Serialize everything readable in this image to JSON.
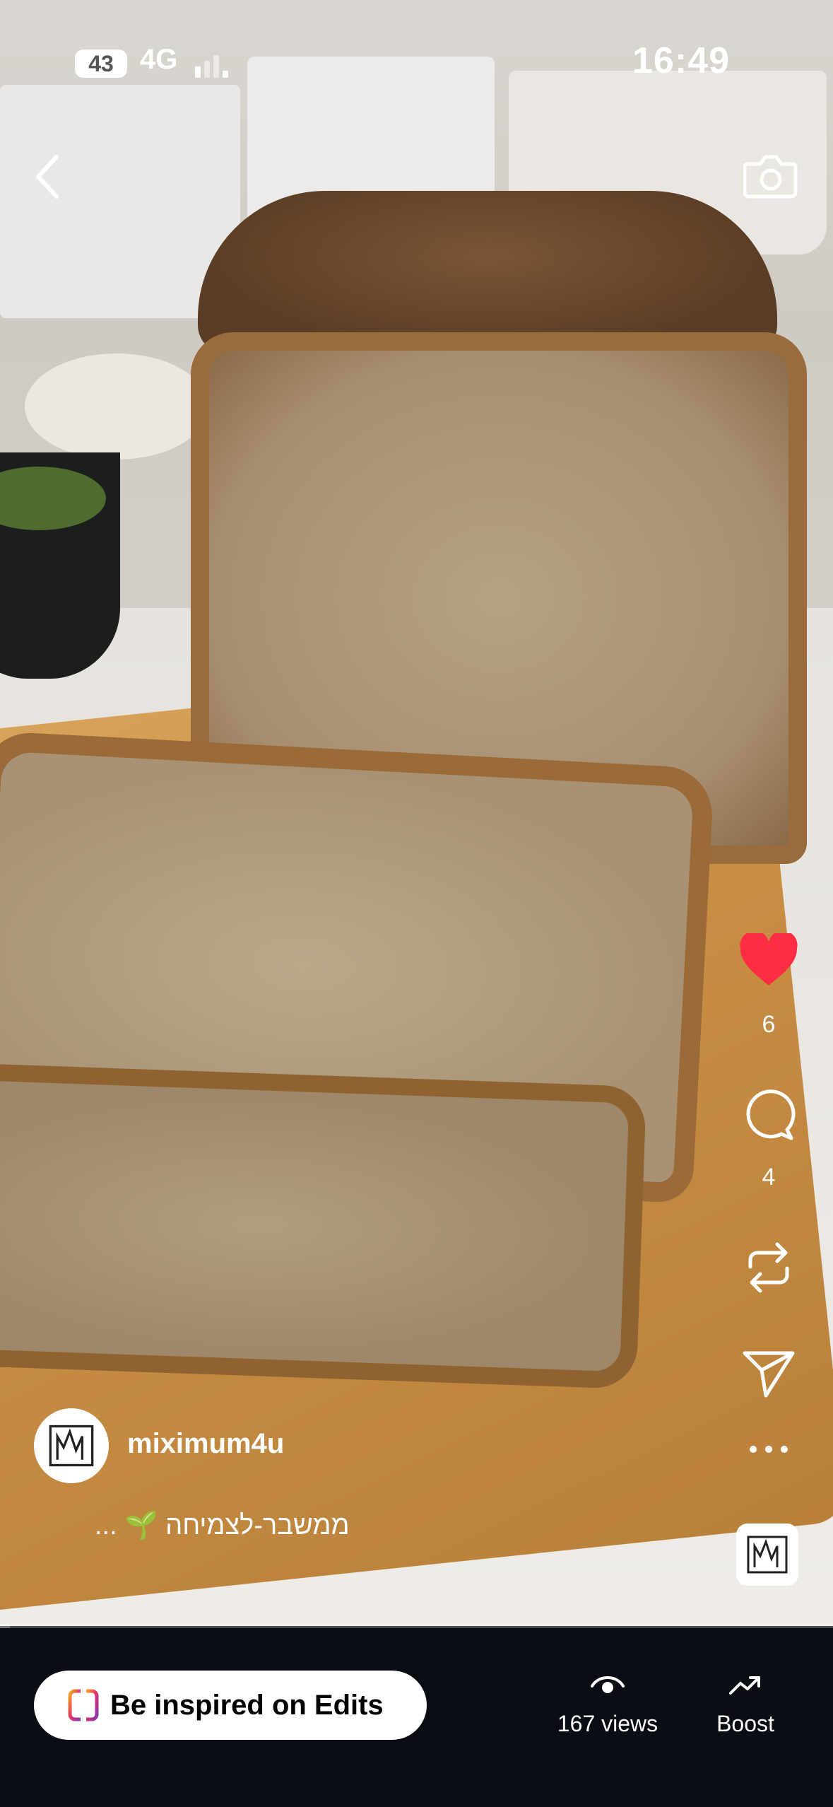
{
  "status_bar": {
    "battery": "43",
    "network": "4G",
    "time": "16:49"
  },
  "header": {
    "back_icon": "chevron-left-icon",
    "camera_icon": "camera-icon"
  },
  "actions": {
    "likes": "6",
    "comments": "4",
    "like_color": "#ff2d43"
  },
  "post": {
    "username": "miximum4u",
    "caption_text": "ממשבר-לצמיחה",
    "caption_emoji": "🌱",
    "caption_more": "..."
  },
  "playback": {
    "progress_fraction": 0.012
  },
  "bottom_bar": {
    "edits_label": "Be inspired on Edits",
    "views_label": "167 views",
    "boost_label": "Boost"
  }
}
